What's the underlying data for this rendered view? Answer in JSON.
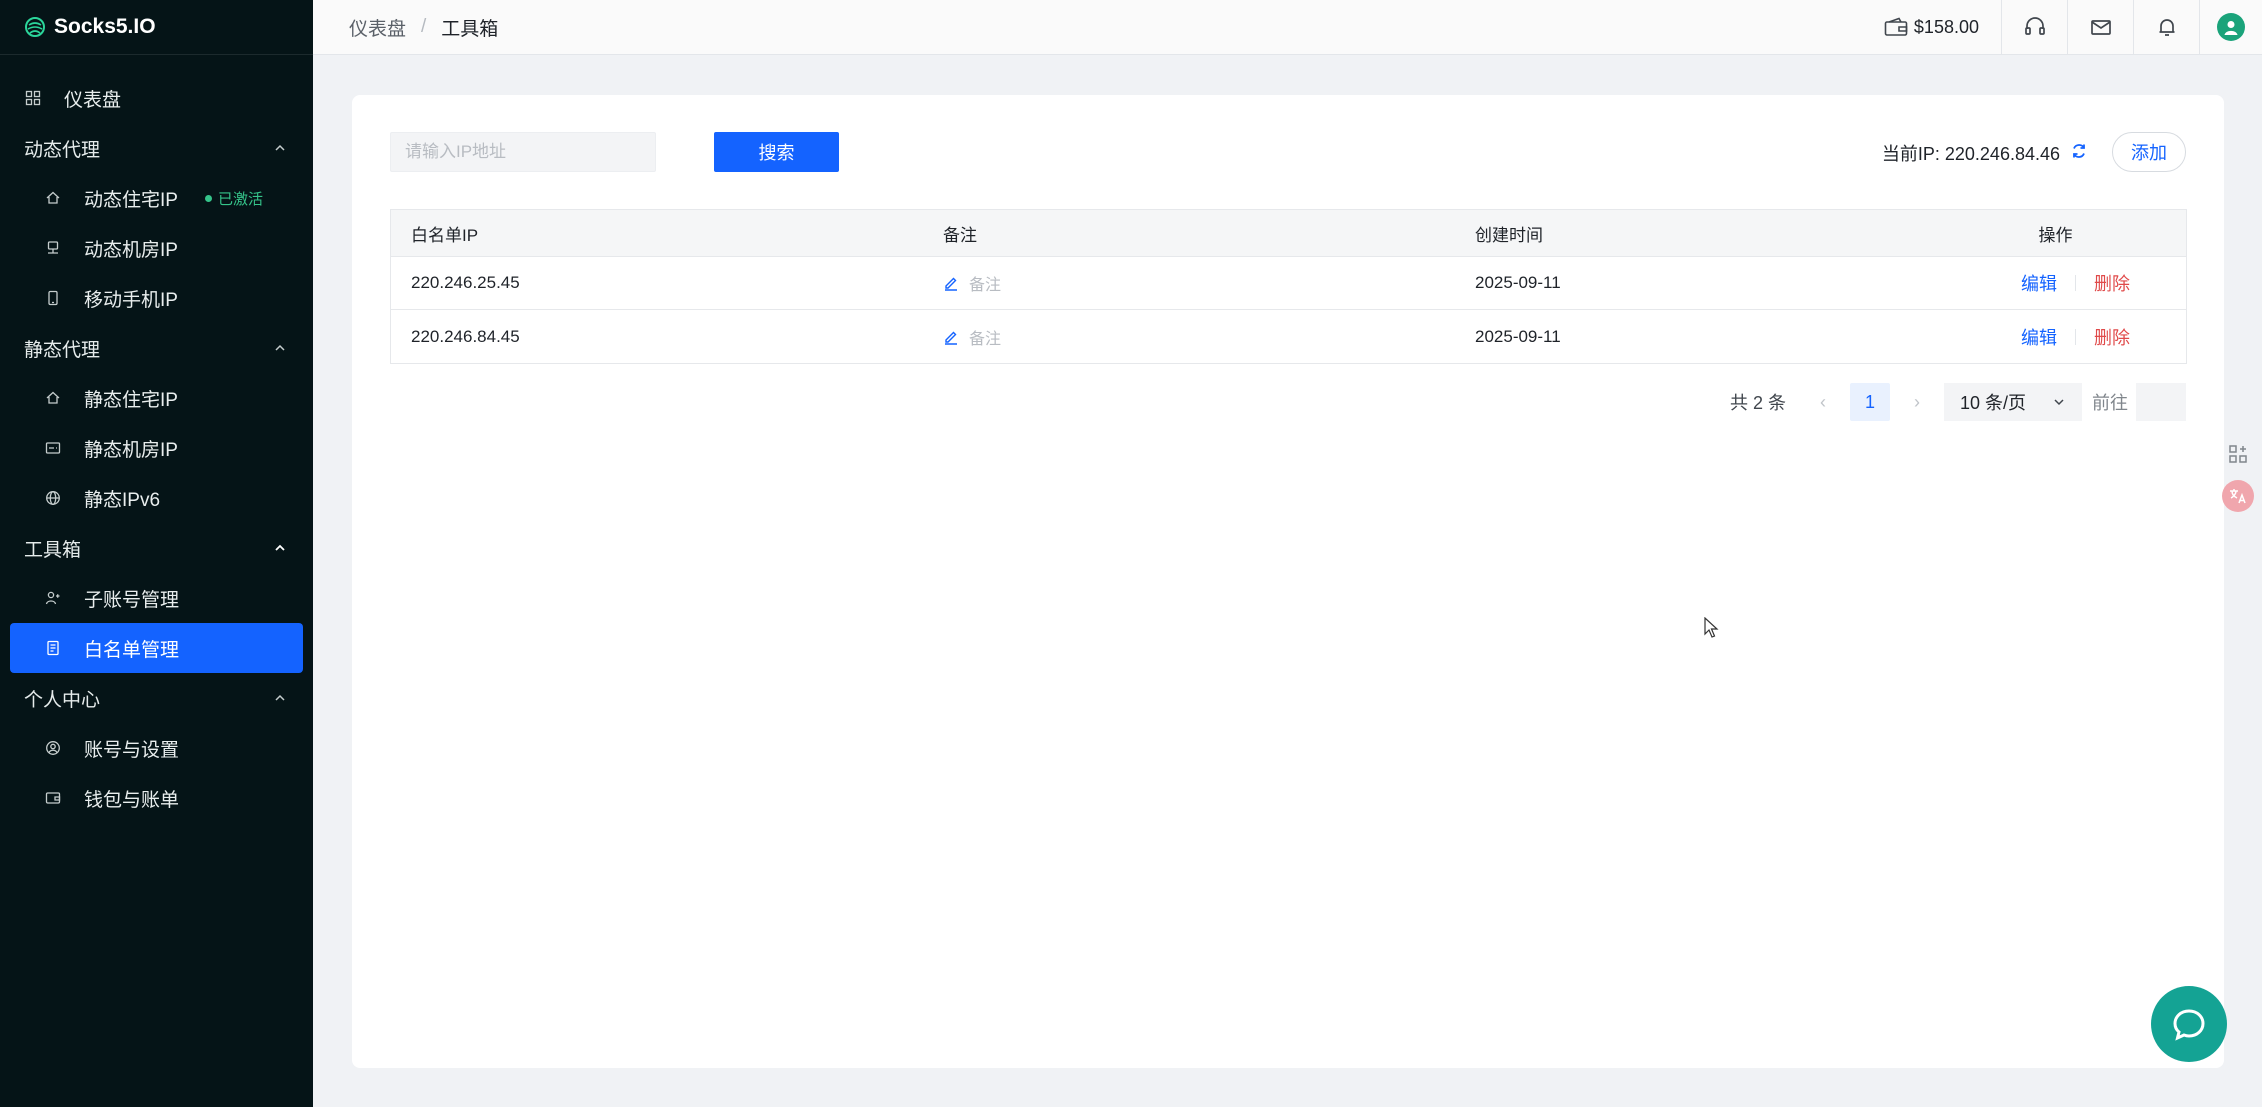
{
  "app": {
    "logo_text": "Socks5.IO"
  },
  "sidebar": {
    "dashboard": "仪表盘",
    "groups": [
      {
        "label": "动态代理",
        "items": [
          {
            "label": "动态住宅IP",
            "badge": "已激活"
          },
          {
            "label": "动态机房IP"
          },
          {
            "label": "移动手机IP"
          }
        ]
      },
      {
        "label": "静态代理",
        "items": [
          {
            "label": "静态住宅IP"
          },
          {
            "label": "静态机房IP"
          },
          {
            "label": "静态IPv6"
          }
        ]
      },
      {
        "label": "工具箱",
        "items": [
          {
            "label": "子账号管理"
          },
          {
            "label": "白名单管理",
            "active": true
          }
        ]
      },
      {
        "label": "个人中心",
        "items": [
          {
            "label": "账号与设置"
          },
          {
            "label": "钱包与账单"
          }
        ]
      }
    ]
  },
  "header": {
    "breadcrumb": [
      "仪表盘",
      "工具箱"
    ],
    "breadcrumb_sep": "/",
    "balance": "$158.00"
  },
  "toolbar": {
    "search_placeholder": "请输入IP地址",
    "search_label": "搜索",
    "current_ip_label": "当前IP: 220.246.84.46",
    "add_label": "添加"
  },
  "table": {
    "columns": [
      "白名单IP",
      "备注",
      "创建时间",
      "操作"
    ],
    "rows": [
      {
        "ip": "220.246.25.45",
        "note": "备注",
        "created": "2025-09-11",
        "edit": "编辑",
        "delete": "删除"
      },
      {
        "ip": "220.246.84.45",
        "note": "备注",
        "created": "2025-09-11",
        "edit": "编辑",
        "delete": "删除"
      }
    ]
  },
  "pagination": {
    "total": "共 2 条",
    "current_page": "1",
    "page_size": "10 条/页",
    "goto": "前往"
  },
  "colors": {
    "accent": "#1463ff",
    "sidebar_bg": "#051417",
    "danger": "#e04a4a",
    "success": "#35c48a"
  }
}
